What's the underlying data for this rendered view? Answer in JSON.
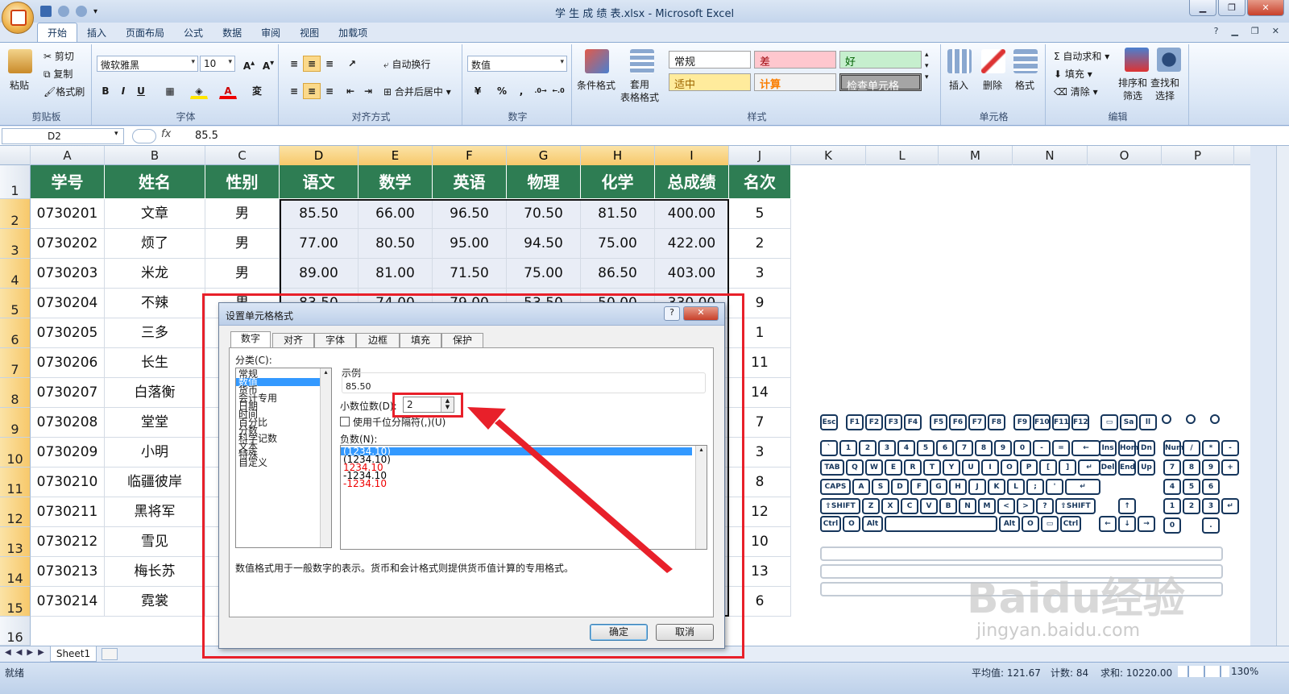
{
  "window": {
    "title": "学 生 成 绩 表.xlsx - Microsoft Excel"
  },
  "ribbon_tabs": [
    "开始",
    "插入",
    "页面布局",
    "公式",
    "数据",
    "审阅",
    "视图",
    "加载项"
  ],
  "clipboard": {
    "paste": "粘贴",
    "cut": "剪切",
    "copy": "复制",
    "format_painter": "格式刷",
    "label": "剪贴板"
  },
  "font": {
    "name": "微软雅黑",
    "size": "10",
    "label": "字体"
  },
  "alignment": {
    "wrap": "自动换行",
    "merge": "合并后居中",
    "label": "对齐方式"
  },
  "number": {
    "format": "数值",
    "label": "数字"
  },
  "styles": {
    "cond": "条件格式",
    "table": "套用\n表格格式",
    "normal": "常规",
    "bad": "差",
    "good": "好",
    "neutral": "适中",
    "calc": "计算",
    "check": "检查单元格",
    "label": "样式"
  },
  "cells": {
    "insert": "插入",
    "delete": "删除",
    "format": "格式",
    "label": "单元格"
  },
  "editing": {
    "autosum": "自动求和",
    "fill": "填充",
    "clear": "清除",
    "sort": "排序和\n筛选",
    "find": "查找和\n选择",
    "label": "编辑"
  },
  "formula_bar": {
    "name_box": "D2",
    "value": "85.5"
  },
  "columns": [
    "A",
    "B",
    "C",
    "D",
    "E",
    "F",
    "G",
    "H",
    "I",
    "J",
    "K",
    "L",
    "M",
    "N",
    "O",
    "P"
  ],
  "rows": [
    "1",
    "2",
    "3",
    "4",
    "5",
    "6",
    "7",
    "8",
    "9",
    "10",
    "11",
    "12",
    "13",
    "14",
    "15",
    "16"
  ],
  "headers": [
    "学号",
    "姓名",
    "性别",
    "语文",
    "数学",
    "英语",
    "物理",
    "化学",
    "总成绩",
    "名次"
  ],
  "data": [
    [
      "0730201",
      "文章",
      "男",
      "85.50",
      "66.00",
      "96.50",
      "70.50",
      "81.50",
      "400.00",
      "5"
    ],
    [
      "0730202",
      "烦了",
      "男",
      "77.00",
      "80.50",
      "95.00",
      "94.50",
      "75.00",
      "422.00",
      "2"
    ],
    [
      "0730203",
      "米龙",
      "男",
      "89.00",
      "81.00",
      "71.50",
      "75.00",
      "86.50",
      "403.00",
      "3"
    ],
    [
      "0730204",
      "不辣",
      "男",
      "83.50",
      "74.00",
      "79.00",
      "53.50",
      "50.00",
      "330.00",
      "9"
    ],
    [
      "0730205",
      "三多",
      "",
      "",
      "",
      "",
      "",
      "",
      "",
      "1"
    ],
    [
      "0730206",
      "长生",
      "",
      "",
      "",
      "",
      "",
      "",
      "",
      "11"
    ],
    [
      "0730207",
      "白落衡",
      "",
      "",
      "",
      "",
      "",
      "",
      "",
      "14"
    ],
    [
      "0730208",
      "堂堂",
      "",
      "",
      "",
      "",
      "",
      "",
      "",
      "7"
    ],
    [
      "0730209",
      "小明",
      "",
      "",
      "",
      "",
      "",
      "",
      "",
      "3"
    ],
    [
      "0730210",
      "临疆彼岸",
      "",
      "",
      "",
      "",
      "",
      "",
      "",
      "8"
    ],
    [
      "0730211",
      "黑将军",
      "",
      "",
      "",
      "",
      "",
      "",
      "",
      "12"
    ],
    [
      "0730212",
      "雪见",
      "",
      "",
      "",
      "",
      "",
      "",
      "",
      "10"
    ],
    [
      "0730213",
      "梅长苏",
      "",
      "",
      "",
      "",
      "",
      "",
      "",
      "13"
    ],
    [
      "0730214",
      "霓裳",
      "",
      "",
      "",
      "",
      "",
      "",
      "",
      "6"
    ]
  ],
  "dialog": {
    "title": "设置单元格格式",
    "tabs": [
      "数字",
      "对齐",
      "字体",
      "边框",
      "填充",
      "保护"
    ],
    "category_label": "分类(C):",
    "categories": [
      "常规",
      "数值",
      "货币",
      "会计专用",
      "日期",
      "时间",
      "百分比",
      "分数",
      "科学记数",
      "文本",
      "特殊",
      "自定义"
    ],
    "sample_label": "示例",
    "sample_value": "85.50",
    "decimals_label": "小数位数(D):",
    "decimals_value": "2",
    "thousands_label": "使用千位分隔符(,)(U)",
    "negative_label": "负数(N):",
    "negatives": [
      "(1234.10)",
      "(1234.10)",
      "1234.10",
      "-1234.10",
      "-1234.10"
    ],
    "description": "数值格式用于一般数字的表示。货币和会计格式则提供货币值计算的专用格式。",
    "ok": "确定",
    "cancel": "取消"
  },
  "sheet_tab": "Sheet1",
  "status": {
    "ready": "就绪",
    "average": "平均值: 121.67",
    "count": "计数: 84",
    "sum": "求和: 10220.00",
    "zoom": "130%"
  },
  "watermark": {
    "logo": "Baidu经验",
    "url": "jingyan.baidu.com"
  },
  "colors": {
    "header_green": "#2e7d53",
    "selection_red": "#e8202a",
    "list_highlight": "#3399ff"
  }
}
